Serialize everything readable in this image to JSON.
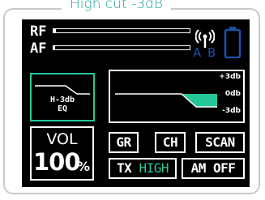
{
  "title": "High cut -3dB",
  "meters": {
    "rf_label": "RF",
    "af_label": "AF",
    "rf_level": 0.02,
    "af_level": 0.01
  },
  "antenna": {
    "icon": "antenna-icon",
    "diversity_a": "A",
    "diversity_b": "B"
  },
  "battery": {
    "icon": "battery-icon"
  },
  "eq": {
    "line1": "H-3db",
    "line2": "EQ"
  },
  "eq_graph": {
    "scale_top": "+3db",
    "scale_mid": "0db",
    "scale_bottom": "-3db"
  },
  "volume": {
    "label": "VOL",
    "value": "100",
    "unit": "%"
  },
  "buttons": {
    "gr": "GR",
    "ch": "CH",
    "scan": "SCAN",
    "tx_prefix": "TX",
    "tx_value": "HIGH",
    "am": "AM OFF"
  },
  "colors": {
    "accent_teal": "#1ea6a0",
    "active_green": "#23c79a",
    "inactive_blue": "#1f4fa8",
    "screen_bg": "#000000"
  }
}
